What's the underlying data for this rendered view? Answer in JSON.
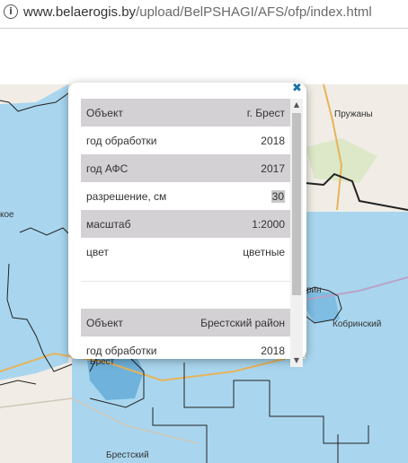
{
  "browser": {
    "url_host": "www.belaerogis.by",
    "url_path": "/upload/BelPSHAGI/AFS/ofp/index.html"
  },
  "map": {
    "labels": {
      "pruzhany": "Пружаны",
      "kobrinsky": "Кобринский",
      "brestsky": "Брестский",
      "brest": "Брест",
      "kobrin_fragment": "рин",
      "left_fragment": "кое"
    },
    "colors": {
      "water_fill": "#a9d6ee",
      "coverage_fill": "#8fc5e4",
      "border": "#222222",
      "background": "#f1ede6"
    }
  },
  "popup": {
    "close_icon": "close-icon",
    "sections": [
      {
        "rows": [
          {
            "key": "Объект",
            "value": "г. Брест"
          },
          {
            "key": "год обработки",
            "value": "2018"
          },
          {
            "key": "год АФС",
            "value": "2017"
          },
          {
            "key": "разрешение, см",
            "value": "30"
          },
          {
            "key": "масштаб",
            "value": "1:2000"
          },
          {
            "key": "цвет",
            "value": "цветные"
          }
        ]
      },
      {
        "rows": [
          {
            "key": "Объект",
            "value": "Брестский район"
          },
          {
            "key": "год обработки",
            "value": "2018"
          }
        ]
      }
    ]
  }
}
